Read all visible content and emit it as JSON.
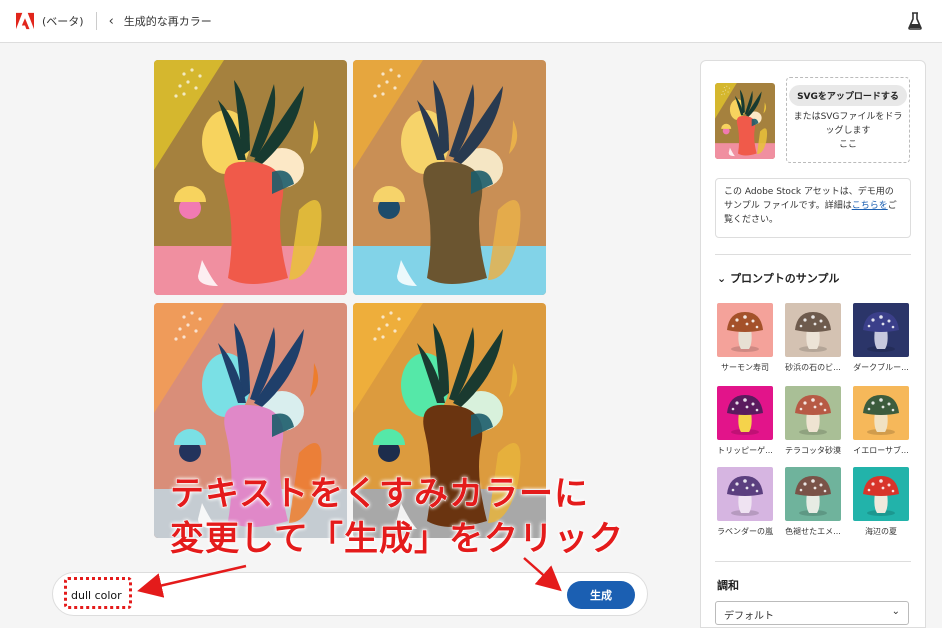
{
  "header": {
    "beta": "(ベータ)",
    "title": "生成的な再カラー"
  },
  "variations": [
    {
      "bg_top": "#a5813e",
      "bg_top_left": "#d5b72e",
      "floor": "#f08fa0",
      "vase": "#f05a4a",
      "leaf": "#173a30",
      "blob1": "#f7d35e",
      "blob2": "#fce8c6",
      "accent": "#e9c23a",
      "dot": "#f17ab2"
    },
    {
      "bg_top": "#c98f55",
      "bg_top_left": "#e6a63e",
      "floor": "#82d3e8",
      "vase": "#6b5530",
      "leaf": "#283a50",
      "blob1": "#f6d36a",
      "blob2": "#f5e6c4",
      "accent": "#e9b04a",
      "dot": "#1d4c6b"
    },
    {
      "bg_top": "#d98e79",
      "bg_top_left": "#ef9b5a",
      "floor": "#c5ccd2",
      "vase": "#e088c8",
      "leaf": "#1f3f6a",
      "blob1": "#7ae0e5",
      "blob2": "#d9eeee",
      "accent": "#ed7d2d",
      "dot": "#23335c"
    },
    {
      "bg_top": "#dc9b3e",
      "bg_top_left": "#eeae3b",
      "floor": "#a8a8a8",
      "vase": "#6a3410",
      "leaf": "#1a3a30",
      "blob1": "#55e8a8",
      "blob2": "#d8f1dc",
      "accent": "#e7b43c",
      "dot": "#1d2d4c"
    }
  ],
  "callout": {
    "line1": "テキストをくすみカラーに",
    "line2": "変更して「生成」をクリック"
  },
  "prompt": {
    "value": "dull color",
    "generate_label": "生成"
  },
  "panel": {
    "upload_label": "SVGをアップロードする",
    "drop_text": "またはSVGファイルをドラッグします\nここ",
    "info_text": "この Adobe Stock アセットは、デモ用のサンプル ファイルです。詳細は",
    "info_link": "こちらを",
    "info_suffix": "ご覧ください。",
    "samples_heading": "プロンプトのサンプル",
    "samples": [
      {
        "label": "サーモン寿司",
        "bg": "#f4a29a",
        "cap": "#a4512a",
        "stem": "#e7e0d3"
      },
      {
        "label": "砂浜の石のビ...",
        "bg": "#d4c2b2",
        "cap": "#6e5b4d",
        "stem": "#ece3d6"
      },
      {
        "label": "ダークブルー...",
        "bg": "#2b3569",
        "cap": "#3b3f8a",
        "stem": "#c7c9dd"
      },
      {
        "label": "トリッピーゲ...",
        "bg": "#e2148a",
        "cap": "#5a1b5e",
        "stem": "#f5d34b"
      },
      {
        "label": "テラコッタ砂漠",
        "bg": "#a9bf96",
        "cap": "#b75a45",
        "stem": "#efe4d2"
      },
      {
        "label": "イエローサブ...",
        "bg": "#f6b85a",
        "cap": "#3c5c3d",
        "stem": "#f1e2c2"
      },
      {
        "label": "ラベンダーの嵐",
        "bg": "#d6b5e1",
        "cap": "#5b3f7f",
        "stem": "#efe3f2"
      },
      {
        "label": "色褪せたエメ...",
        "bg": "#6fb39c",
        "cap": "#7a5348",
        "stem": "#e7ece4"
      },
      {
        "label": "海辺の夏",
        "bg": "#22b3aa",
        "cap": "#d8342a",
        "stem": "#efe9dc"
      }
    ],
    "harmony_heading": "調和",
    "harmony_value": "デフォルト"
  }
}
